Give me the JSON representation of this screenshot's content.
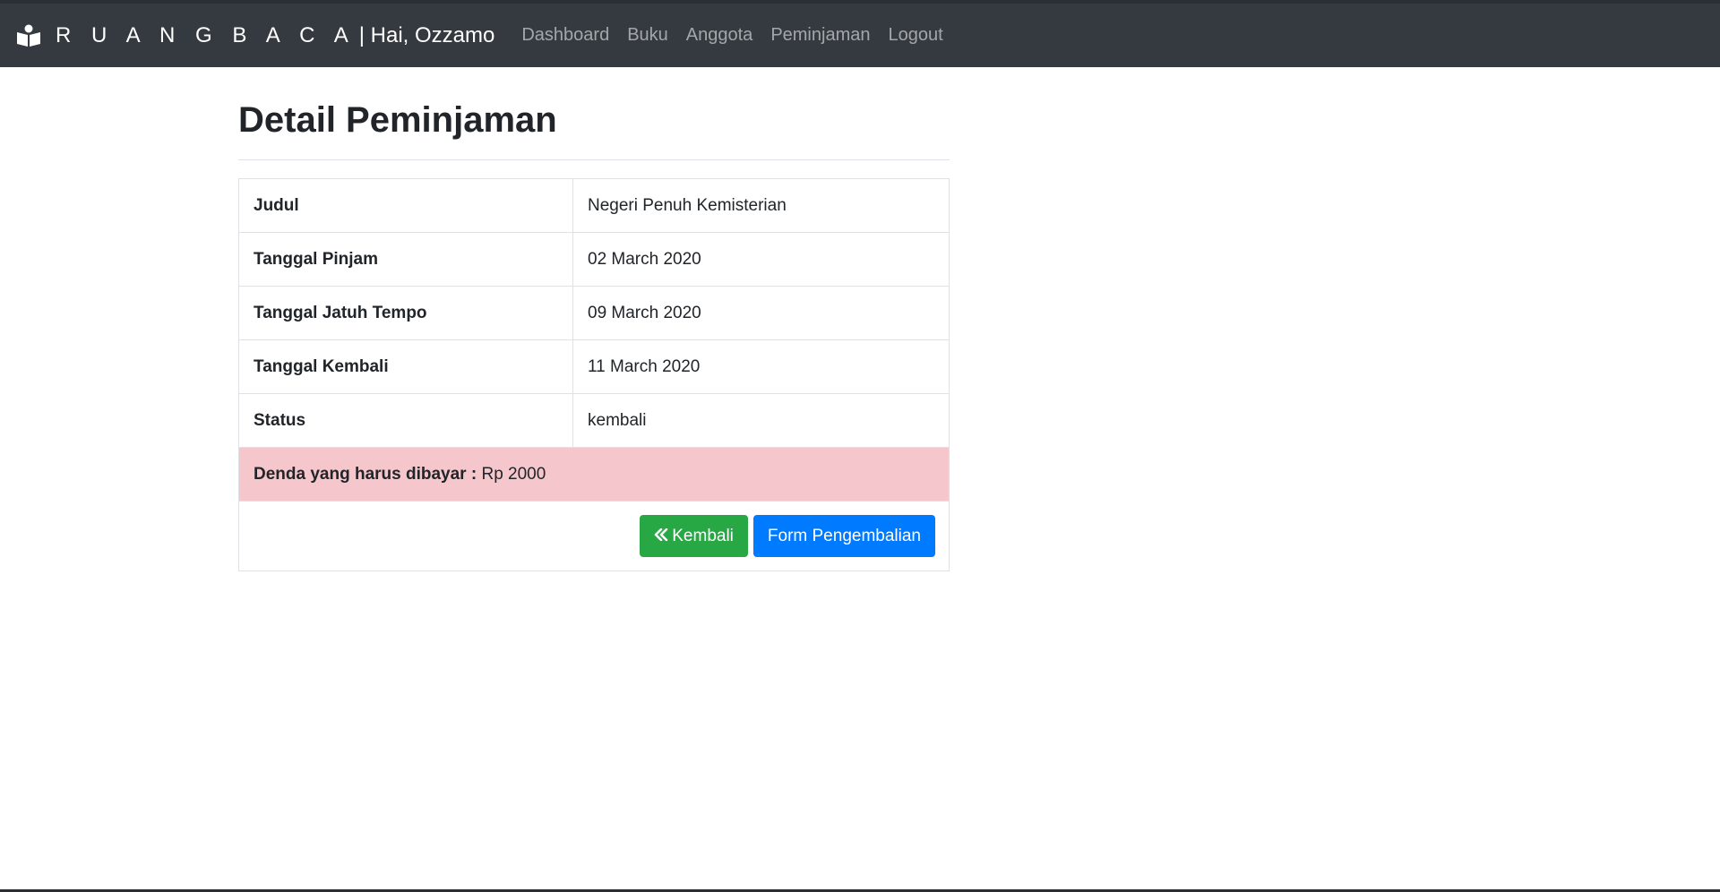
{
  "navbar": {
    "brand_name": "R U A N G B A C A",
    "brand_greeting": "| Hai, Ozzamo",
    "brand_icon": "reading-person-icon",
    "links": [
      "Dashboard",
      "Buku",
      "Anggota",
      "Peminjaman",
      "Logout"
    ]
  },
  "page": {
    "title": "Detail Peminjaman"
  },
  "detail": {
    "rows": [
      {
        "label": "Judul",
        "value": "Negeri Penuh Kemisterian"
      },
      {
        "label": "Tanggal Pinjam",
        "value": "02 March 2020"
      },
      {
        "label": "Tanggal Jatuh Tempo",
        "value": "09 March 2020"
      },
      {
        "label": "Tanggal Kembali",
        "value": "11 March 2020"
      },
      {
        "label": "Status",
        "value": "kembali"
      }
    ],
    "fine_label": "Denda yang harus dibayar :",
    "fine_value": "Rp 2000"
  },
  "actions": {
    "back_label": "Kembali",
    "back_icon": "double-chevron-left-icon",
    "return_form_label": "Form Pengembalian"
  },
  "colors": {
    "navbar": "#343a40",
    "success": "#28a745",
    "primary": "#007bff",
    "danger_light": "#f5c6cb"
  }
}
